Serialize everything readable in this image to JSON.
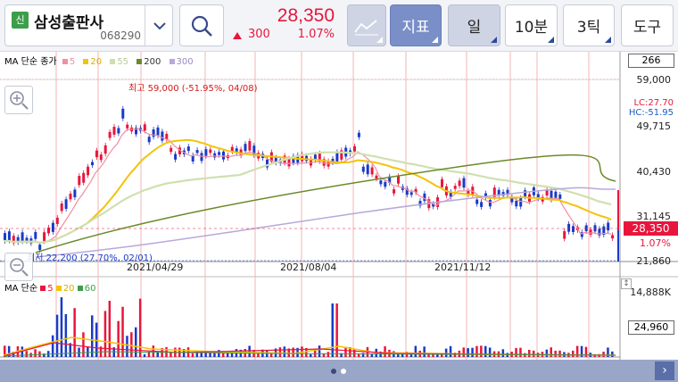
{
  "stock": {
    "tag": "신",
    "name": "삼성출판사",
    "code": "068290"
  },
  "quote": {
    "price": "28,350",
    "change": "300",
    "rate": "1.07%"
  },
  "toolbar": {
    "indicator_label": "지표",
    "period_label": "일",
    "minute_label": "10분",
    "tick_label": "3틱",
    "tools_label": "도구"
  },
  "price_chart": {
    "legend": {
      "title": "MA 단순 종가",
      "ma": [
        {
          "label": "5",
          "color": "#f08fa0"
        },
        {
          "label": "20",
          "color": "#f2c40a"
        },
        {
          "label": "55",
          "color": "#cfe0b0"
        },
        {
          "label": "200",
          "color": "#6a8a2a"
        },
        {
          "label": "300",
          "color": "#b8a8d8"
        }
      ]
    },
    "axis_labels": [
      "266",
      "59,000",
      "49,715",
      "40,430",
      "31,145",
      "21,860"
    ],
    "high_annotation": "최고 59,000 (-51.95%, 04/08)",
    "low_annotation": "최저 22,200 (27.70%, 02/01)",
    "lc": "LC:27.70",
    "hc": "HC:-51.95",
    "current_price_label": "28,350",
    "current_rate_label": "1.07%",
    "dates": [
      "2021/04/29",
      "2021/08/04",
      "2021/11/12"
    ]
  },
  "volume_chart": {
    "legend": {
      "title": "MA 단순",
      "ma": [
        {
          "label": "5",
          "color": "#e8163c"
        },
        {
          "label": "20",
          "color": "#f2c40a"
        },
        {
          "label": "60",
          "color": "#3c9e4a"
        }
      ]
    },
    "axis_label": "14,888K",
    "current_volume_label": "24,960"
  },
  "colors": {
    "rise": "#e8163c",
    "fall": "#1a3ac8",
    "header_bg": "#f3f4f8",
    "footer_bg": "#9aa6c8"
  },
  "icons": {
    "dropdown": "chevron-down-icon",
    "search": "search-icon",
    "chart": "line-chart-icon",
    "zoom_in": "zoom-in-icon",
    "zoom_out": "zoom-out-icon",
    "next": "chevron-right-icon"
  }
}
